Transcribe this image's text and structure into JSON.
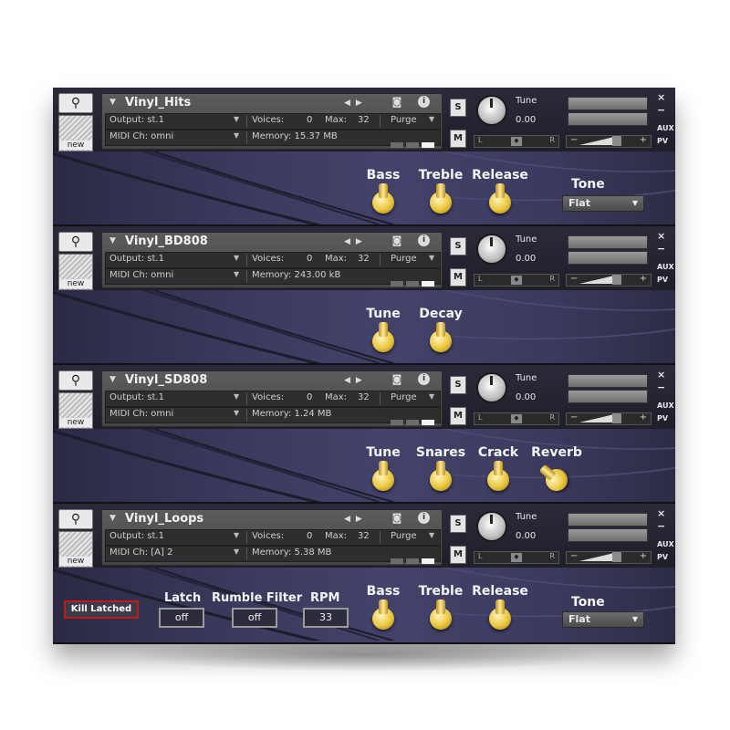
{
  "instruments": [
    {
      "name": "Vinyl_Hits",
      "output": "Output:  st.1",
      "midi": "MIDI Ch:  omni",
      "voices_label": "Voices:",
      "voices": "0",
      "max_label": "Max:",
      "max": "32",
      "memory": "Memory:  15.37 MB",
      "purge": "Purge",
      "tune_label": "Tune",
      "tune_value": "0.00",
      "controls": [
        {
          "label": "Bass"
        },
        {
          "label": "Treble"
        },
        {
          "label": "Release"
        }
      ],
      "tone_label": "Tone",
      "tone_value": "Flat"
    },
    {
      "name": "Vinyl_BD808",
      "output": "Output:  st.1",
      "midi": "MIDI Ch:  omni",
      "voices_label": "Voices:",
      "voices": "0",
      "max_label": "Max:",
      "max": "32",
      "memory": "Memory:  243.00 kB",
      "purge": "Purge",
      "tune_label": "Tune",
      "tune_value": "0.00",
      "controls": [
        {
          "label": "Tune"
        },
        {
          "label": "Decay"
        }
      ]
    },
    {
      "name": "Vinyl_SD808",
      "output": "Output:  st.1",
      "midi": "MIDI Ch:  omni",
      "voices_label": "Voices:",
      "voices": "0",
      "max_label": "Max:",
      "max": "32",
      "memory": "Memory:  1.24 MB",
      "purge": "Purge",
      "tune_label": "Tune",
      "tune_value": "0.00",
      "controls": [
        {
          "label": "Tune"
        },
        {
          "label": "Snares"
        },
        {
          "label": "Crack"
        },
        {
          "label": "Reverb"
        }
      ]
    },
    {
      "name": "Vinyl_Loops",
      "output": "Output:  st.1",
      "midi": "MIDI Ch:  [A]  2",
      "voices_label": "Voices:",
      "voices": "0",
      "max_label": "Max:",
      "max": "32",
      "memory": "Memory:  5.38 MB",
      "purge": "Purge",
      "tune_label": "Tune",
      "tune_value": "0.00",
      "controls": [
        {
          "label": "Bass"
        },
        {
          "label": "Treble"
        },
        {
          "label": "Release"
        }
      ],
      "tone_label": "Tone",
      "tone_value": "Flat",
      "kill_label": "Kill Latched",
      "latch_label": "Latch",
      "latch_value": "off",
      "rumble_label": "Rumble  Filter",
      "rumble_value": "off",
      "rpm_label": "RPM",
      "rpm_value": "33"
    }
  ],
  "common": {
    "new_label": "new",
    "s_label": "S",
    "m_label": "M",
    "pan_left": "L",
    "pan_right": "R",
    "aux": "AUX",
    "pv": "PV",
    "close": "×",
    "minus": "−",
    "vol_minus": "−",
    "vol_plus": "+"
  },
  "icons": [
    "wrench-icon",
    "camera-icon",
    "info-icon",
    "prev-icon",
    "next-icon",
    "output-icon",
    "midi-icon",
    "voices-icon",
    "memory-icon"
  ],
  "colors": {
    "knob_gold": "#e9c63c",
    "kill_border": "#c01919",
    "panel": "#454545"
  }
}
